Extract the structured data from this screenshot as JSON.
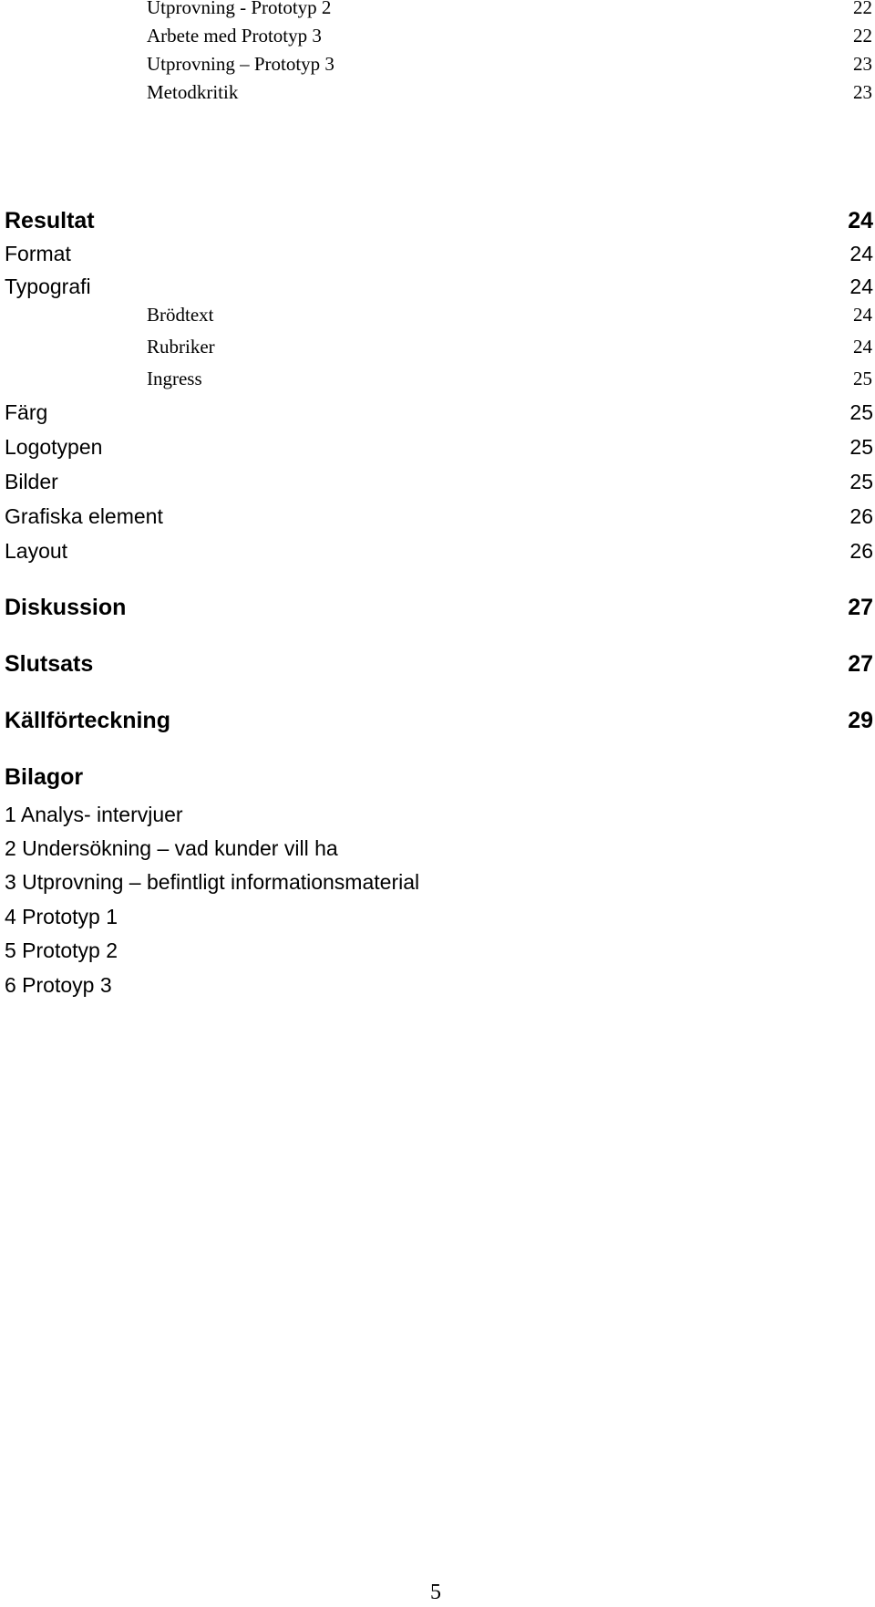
{
  "toc": {
    "subentries_top": [
      {
        "label": "Utprovning - Prototyp 2",
        "page": "22"
      },
      {
        "label": "Arbete med Prototyp 3",
        "page": "22"
      },
      {
        "label": "Utprovning – Prototyp 3",
        "page": "23"
      },
      {
        "label": "Metodkritik",
        "page": "23"
      }
    ],
    "resultat": {
      "label": "Resultat",
      "page": "24"
    },
    "resultat_items": [
      {
        "label": "Format",
        "page": "24"
      },
      {
        "label": "Typografi",
        "page": "24"
      }
    ],
    "typografi_sub": [
      {
        "label": "Brödtext",
        "page": "24"
      },
      {
        "label": "Rubriker",
        "page": "24"
      },
      {
        "label": "Ingress",
        "page": "25"
      }
    ],
    "resultat_items_2": [
      {
        "label": "Färg",
        "page": "25"
      },
      {
        "label": "Logotypen",
        "page": "25"
      },
      {
        "label": "Bilder",
        "page": "25"
      },
      {
        "label": "Grafiska element",
        "page": "26"
      },
      {
        "label": "Layout",
        "page": "26"
      }
    ],
    "diskussion": {
      "label": "Diskussion",
      "page": "27"
    },
    "slutsats": {
      "label": "Slutsats",
      "page": "27"
    },
    "kallforteckning": {
      "label": "Källförteckning",
      "page": "29"
    },
    "bilagor": {
      "label": "Bilagor",
      "items": [
        "1 Analys- intervjuer",
        "2 Undersökning – vad kunder vill ha",
        "3 Utprovning – befintligt informationsmaterial",
        "4 Prototyp 1",
        "5 Prototyp 2",
        "6 Protoyp 3"
      ]
    }
  },
  "footer": {
    "page_number": "5"
  }
}
